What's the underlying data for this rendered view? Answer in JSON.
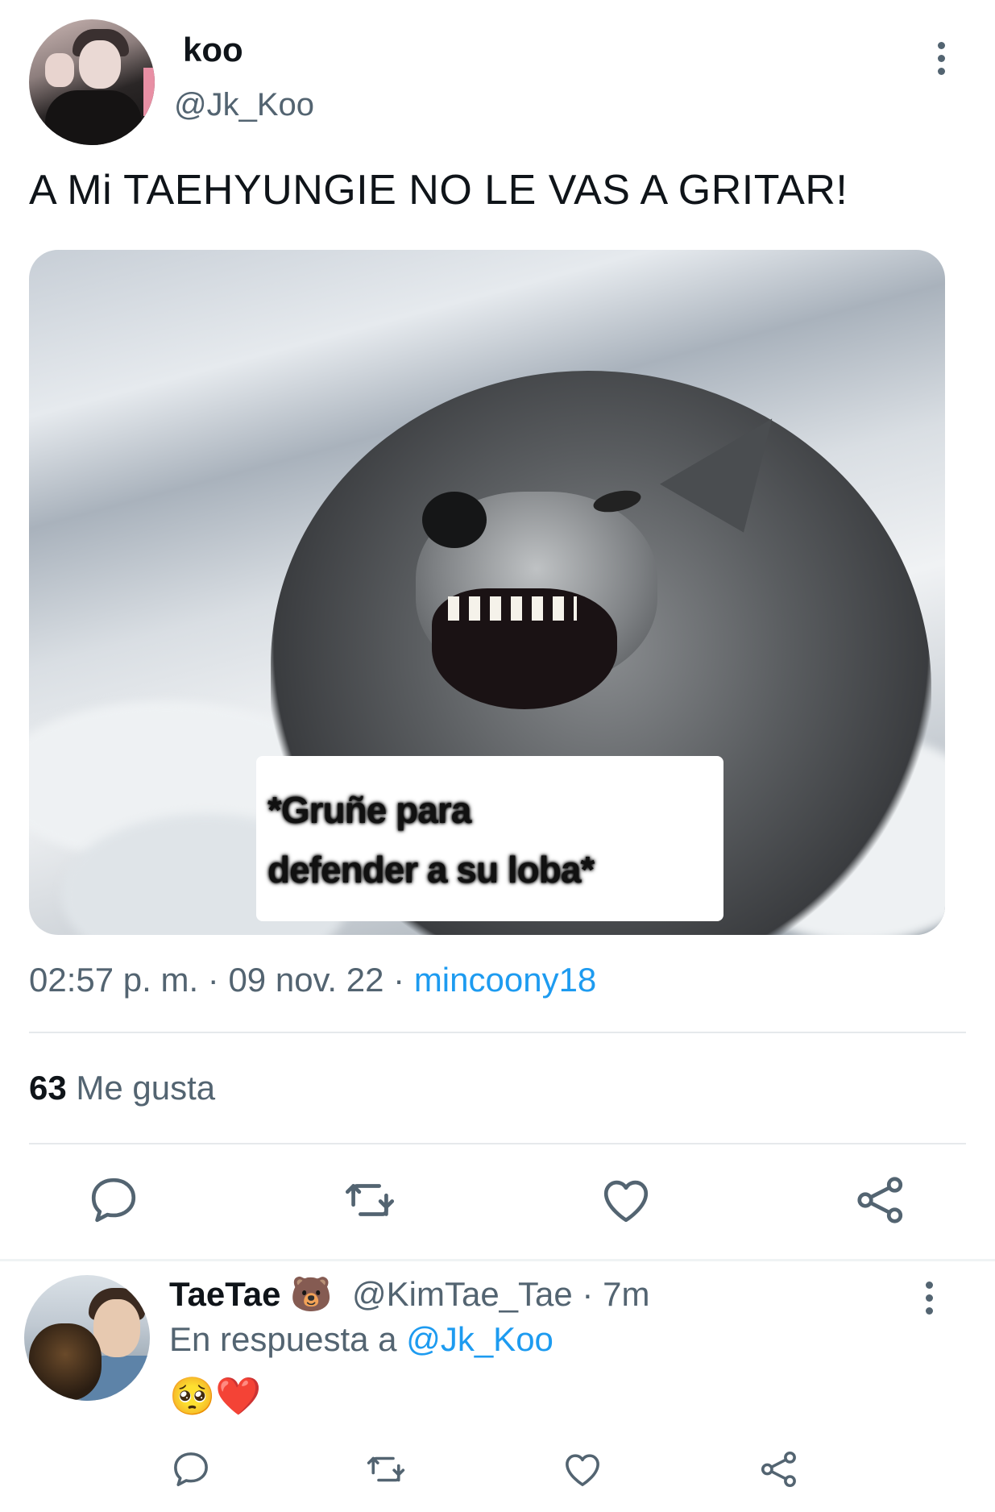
{
  "tweet": {
    "author_name": "koo",
    "author_handle": "@Jk_Koo",
    "text": "A Mi TAEHYUNGIE NO LE VAS A GRITAR!",
    "image_caption_line1": "*Gruñe para",
    "image_caption_line2": "defender a su loba*",
    "time": "02:57 p. m. · 09 nov. 22 · ",
    "source": "mincoony18",
    "likes_count": "63",
    "likes_label": "Me gusta"
  },
  "reply": {
    "author_name": "TaeTae 🐻",
    "author_handle": "@KimTae_Tae · 7m",
    "replying_to_label": "En respuesta a ",
    "replying_to_handle": "@Jk_Koo",
    "text": "🥺❤️"
  },
  "icons": {
    "reply": "reply-icon",
    "retweet": "retweet-icon",
    "like": "heart-icon",
    "share": "share-icon",
    "more": "more-vertical-icon"
  },
  "colors": {
    "accent": "#1d9bf0",
    "secondary_text": "#536471",
    "primary_text": "#0f1419"
  }
}
